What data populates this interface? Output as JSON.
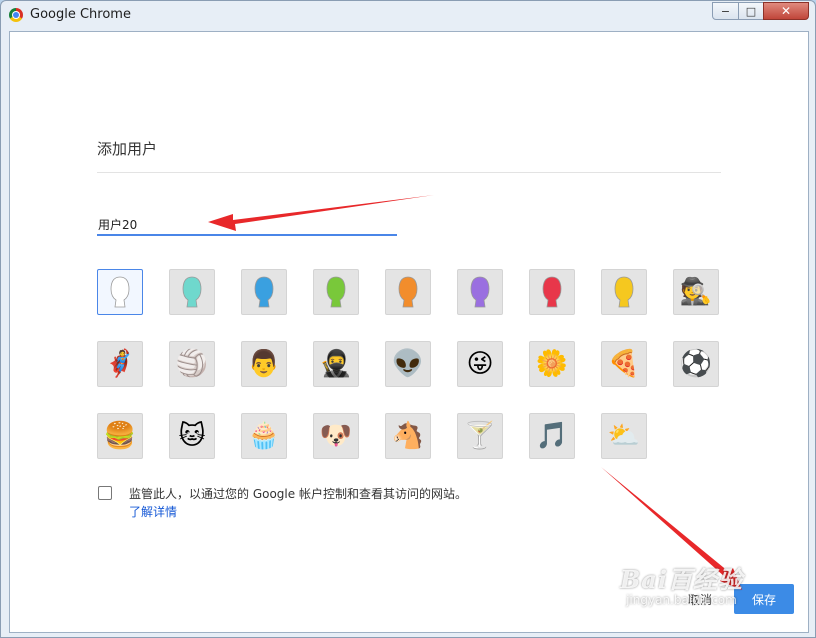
{
  "window": {
    "title": "Google Chrome"
  },
  "controls": {
    "minimize": "−",
    "maximize": "□",
    "close": "✕"
  },
  "dialog": {
    "heading": "添加用户",
    "name_value": "用户20",
    "supervise_text": "监管此人，以通过您的 Google 帐户控制和查看其访问的网站。",
    "learn_more": "了解详情",
    "cancel_label": "取消",
    "save_label": "保存"
  },
  "avatars": [
    {
      "name": "generic-white",
      "glyph": "",
      "color": "#ffffff",
      "selected": true
    },
    {
      "name": "generic-aqua",
      "glyph": "",
      "color": "#6fd8cd"
    },
    {
      "name": "generic-blue",
      "glyph": "",
      "color": "#3aa0e0"
    },
    {
      "name": "generic-green",
      "glyph": "",
      "color": "#79c83a"
    },
    {
      "name": "generic-orange",
      "glyph": "",
      "color": "#f28d2c"
    },
    {
      "name": "generic-purple",
      "glyph": "",
      "color": "#9a6fe0"
    },
    {
      "name": "generic-red",
      "glyph": "",
      "color": "#e8374a"
    },
    {
      "name": "generic-yellow",
      "glyph": "",
      "color": "#f5c81f"
    },
    {
      "name": "secret-agent",
      "glyph": "🕵"
    },
    {
      "name": "superhero",
      "glyph": "🦸"
    },
    {
      "name": "volleyball-player",
      "glyph": "🏐"
    },
    {
      "name": "businessman",
      "glyph": "👨"
    },
    {
      "name": "ninja",
      "glyph": "🥷"
    },
    {
      "name": "alien",
      "glyph": "👽"
    },
    {
      "name": "awesome",
      "glyph": "😜"
    },
    {
      "name": "flower",
      "glyph": "🌼"
    },
    {
      "name": "pizza",
      "glyph": "🍕"
    },
    {
      "name": "soccer",
      "glyph": "⚽"
    },
    {
      "name": "burger",
      "glyph": "🍔"
    },
    {
      "name": "cat",
      "glyph": "🐱"
    },
    {
      "name": "cupcake",
      "glyph": "🧁"
    },
    {
      "name": "dog",
      "glyph": "🐶"
    },
    {
      "name": "horse",
      "glyph": "🐴"
    },
    {
      "name": "margarita",
      "glyph": "🍸"
    },
    {
      "name": "note",
      "glyph": "🎵"
    },
    {
      "name": "sun-cloud",
      "glyph": "⛅"
    }
  ],
  "watermark": {
    "main": "Bai百经验",
    "sub": "jingyan.baidu.com"
  },
  "colors": {
    "accent": "#4a86e8",
    "save": "#3c8be6",
    "arrow": "#e8282a",
    "link": "#1558d6"
  }
}
